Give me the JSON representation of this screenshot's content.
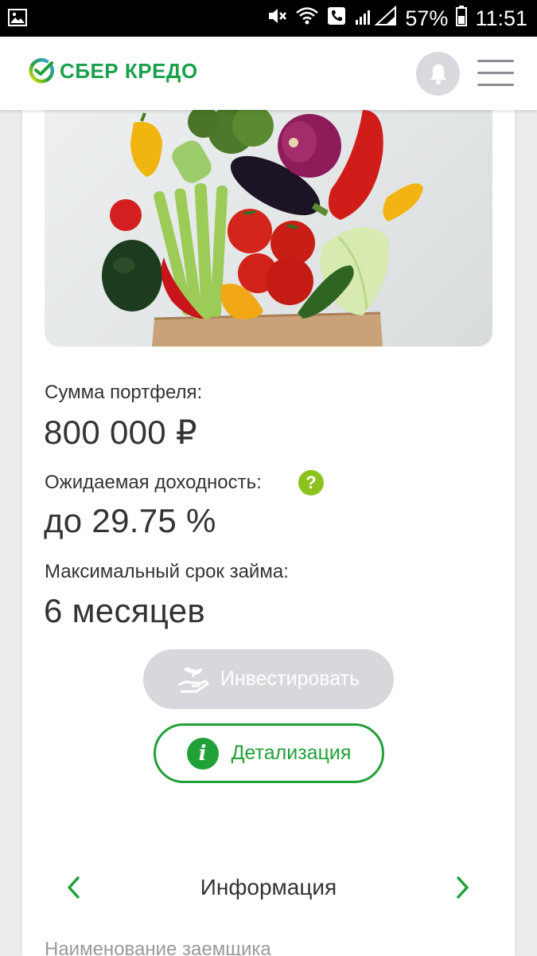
{
  "status_bar": {
    "battery": "57%",
    "time": "11:51"
  },
  "header": {
    "brand": "СБЕР КРЕДО"
  },
  "card": {
    "portfolio_label": "Сумма портфеля:",
    "portfolio_value": "800 000 ₽",
    "yield_label": "Ожидаемая доходность:",
    "yield_help": "?",
    "yield_value": "до 29.75 %",
    "term_label": "Максимальный срок займа:",
    "term_value": "6 месяцев",
    "invest_button": "Инвестировать",
    "detail_button": "Детализация",
    "detail_icon": "i"
  },
  "info_section": {
    "title": "Информация",
    "first_field_label": "Наименование заемщика"
  },
  "colors": {
    "accent_green": "#21a038",
    "help_green": "#8cc21e",
    "disabled_button": "#d6d8db"
  }
}
